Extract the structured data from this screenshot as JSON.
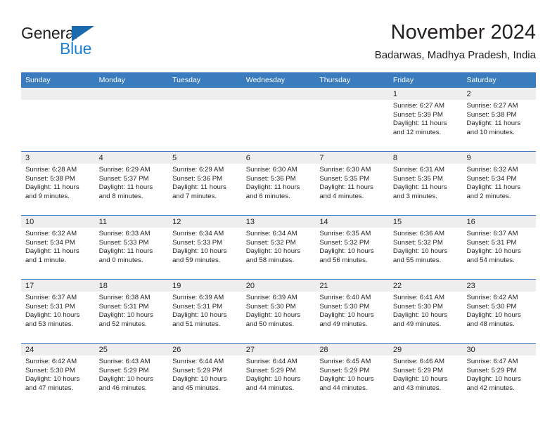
{
  "brand": {
    "name_top": "General",
    "name_bottom": "Blue",
    "triangle_color": "#1b6ab0",
    "blue_color": "#1b7fd4"
  },
  "header": {
    "month_title": "November 2024",
    "location": "Badarwas, Madhya Pradesh, India"
  },
  "theme": {
    "header_blue": "#3a7cbe",
    "day_band_grey": "#eeeeee",
    "text_color": "#231f20"
  },
  "weekdays": [
    "Sunday",
    "Monday",
    "Tuesday",
    "Wednesday",
    "Thursday",
    "Friday",
    "Saturday"
  ],
  "weeks": [
    [
      {
        "day": "",
        "sunrise": "",
        "sunset": "",
        "daylight": "",
        "empty": true
      },
      {
        "day": "",
        "sunrise": "",
        "sunset": "",
        "daylight": "",
        "empty": true
      },
      {
        "day": "",
        "sunrise": "",
        "sunset": "",
        "daylight": "",
        "empty": true
      },
      {
        "day": "",
        "sunrise": "",
        "sunset": "",
        "daylight": "",
        "empty": true
      },
      {
        "day": "",
        "sunrise": "",
        "sunset": "",
        "daylight": "",
        "empty": true
      },
      {
        "day": "1",
        "sunrise": "Sunrise: 6:27 AM",
        "sunset": "Sunset: 5:39 PM",
        "daylight": "Daylight: 11 hours and 12 minutes.",
        "empty": false
      },
      {
        "day": "2",
        "sunrise": "Sunrise: 6:27 AM",
        "sunset": "Sunset: 5:38 PM",
        "daylight": "Daylight: 11 hours and 10 minutes.",
        "empty": false
      }
    ],
    [
      {
        "day": "3",
        "sunrise": "Sunrise: 6:28 AM",
        "sunset": "Sunset: 5:38 PM",
        "daylight": "Daylight: 11 hours and 9 minutes.",
        "empty": false
      },
      {
        "day": "4",
        "sunrise": "Sunrise: 6:29 AM",
        "sunset": "Sunset: 5:37 PM",
        "daylight": "Daylight: 11 hours and 8 minutes.",
        "empty": false
      },
      {
        "day": "5",
        "sunrise": "Sunrise: 6:29 AM",
        "sunset": "Sunset: 5:36 PM",
        "daylight": "Daylight: 11 hours and 7 minutes.",
        "empty": false
      },
      {
        "day": "6",
        "sunrise": "Sunrise: 6:30 AM",
        "sunset": "Sunset: 5:36 PM",
        "daylight": "Daylight: 11 hours and 6 minutes.",
        "empty": false
      },
      {
        "day": "7",
        "sunrise": "Sunrise: 6:30 AM",
        "sunset": "Sunset: 5:35 PM",
        "daylight": "Daylight: 11 hours and 4 minutes.",
        "empty": false
      },
      {
        "day": "8",
        "sunrise": "Sunrise: 6:31 AM",
        "sunset": "Sunset: 5:35 PM",
        "daylight": "Daylight: 11 hours and 3 minutes.",
        "empty": false
      },
      {
        "day": "9",
        "sunrise": "Sunrise: 6:32 AM",
        "sunset": "Sunset: 5:34 PM",
        "daylight": "Daylight: 11 hours and 2 minutes.",
        "empty": false
      }
    ],
    [
      {
        "day": "10",
        "sunrise": "Sunrise: 6:32 AM",
        "sunset": "Sunset: 5:34 PM",
        "daylight": "Daylight: 11 hours and 1 minute.",
        "empty": false
      },
      {
        "day": "11",
        "sunrise": "Sunrise: 6:33 AM",
        "sunset": "Sunset: 5:33 PM",
        "daylight": "Daylight: 11 hours and 0 minutes.",
        "empty": false
      },
      {
        "day": "12",
        "sunrise": "Sunrise: 6:34 AM",
        "sunset": "Sunset: 5:33 PM",
        "daylight": "Daylight: 10 hours and 59 minutes.",
        "empty": false
      },
      {
        "day": "13",
        "sunrise": "Sunrise: 6:34 AM",
        "sunset": "Sunset: 5:32 PM",
        "daylight": "Daylight: 10 hours and 58 minutes.",
        "empty": false
      },
      {
        "day": "14",
        "sunrise": "Sunrise: 6:35 AM",
        "sunset": "Sunset: 5:32 PM",
        "daylight": "Daylight: 10 hours and 56 minutes.",
        "empty": false
      },
      {
        "day": "15",
        "sunrise": "Sunrise: 6:36 AM",
        "sunset": "Sunset: 5:32 PM",
        "daylight": "Daylight: 10 hours and 55 minutes.",
        "empty": false
      },
      {
        "day": "16",
        "sunrise": "Sunrise: 6:37 AM",
        "sunset": "Sunset: 5:31 PM",
        "daylight": "Daylight: 10 hours and 54 minutes.",
        "empty": false
      }
    ],
    [
      {
        "day": "17",
        "sunrise": "Sunrise: 6:37 AM",
        "sunset": "Sunset: 5:31 PM",
        "daylight": "Daylight: 10 hours and 53 minutes.",
        "empty": false
      },
      {
        "day": "18",
        "sunrise": "Sunrise: 6:38 AM",
        "sunset": "Sunset: 5:31 PM",
        "daylight": "Daylight: 10 hours and 52 minutes.",
        "empty": false
      },
      {
        "day": "19",
        "sunrise": "Sunrise: 6:39 AM",
        "sunset": "Sunset: 5:31 PM",
        "daylight": "Daylight: 10 hours and 51 minutes.",
        "empty": false
      },
      {
        "day": "20",
        "sunrise": "Sunrise: 6:39 AM",
        "sunset": "Sunset: 5:30 PM",
        "daylight": "Daylight: 10 hours and 50 minutes.",
        "empty": false
      },
      {
        "day": "21",
        "sunrise": "Sunrise: 6:40 AM",
        "sunset": "Sunset: 5:30 PM",
        "daylight": "Daylight: 10 hours and 49 minutes.",
        "empty": false
      },
      {
        "day": "22",
        "sunrise": "Sunrise: 6:41 AM",
        "sunset": "Sunset: 5:30 PM",
        "daylight": "Daylight: 10 hours and 49 minutes.",
        "empty": false
      },
      {
        "day": "23",
        "sunrise": "Sunrise: 6:42 AM",
        "sunset": "Sunset: 5:30 PM",
        "daylight": "Daylight: 10 hours and 48 minutes.",
        "empty": false
      }
    ],
    [
      {
        "day": "24",
        "sunrise": "Sunrise: 6:42 AM",
        "sunset": "Sunset: 5:30 PM",
        "daylight": "Daylight: 10 hours and 47 minutes.",
        "empty": false
      },
      {
        "day": "25",
        "sunrise": "Sunrise: 6:43 AM",
        "sunset": "Sunset: 5:29 PM",
        "daylight": "Daylight: 10 hours and 46 minutes.",
        "empty": false
      },
      {
        "day": "26",
        "sunrise": "Sunrise: 6:44 AM",
        "sunset": "Sunset: 5:29 PM",
        "daylight": "Daylight: 10 hours and 45 minutes.",
        "empty": false
      },
      {
        "day": "27",
        "sunrise": "Sunrise: 6:44 AM",
        "sunset": "Sunset: 5:29 PM",
        "daylight": "Daylight: 10 hours and 44 minutes.",
        "empty": false
      },
      {
        "day": "28",
        "sunrise": "Sunrise: 6:45 AM",
        "sunset": "Sunset: 5:29 PM",
        "daylight": "Daylight: 10 hours and 44 minutes.",
        "empty": false
      },
      {
        "day": "29",
        "sunrise": "Sunrise: 6:46 AM",
        "sunset": "Sunset: 5:29 PM",
        "daylight": "Daylight: 10 hours and 43 minutes.",
        "empty": false
      },
      {
        "day": "30",
        "sunrise": "Sunrise: 6:47 AM",
        "sunset": "Sunset: 5:29 PM",
        "daylight": "Daylight: 10 hours and 42 minutes.",
        "empty": false
      }
    ]
  ]
}
